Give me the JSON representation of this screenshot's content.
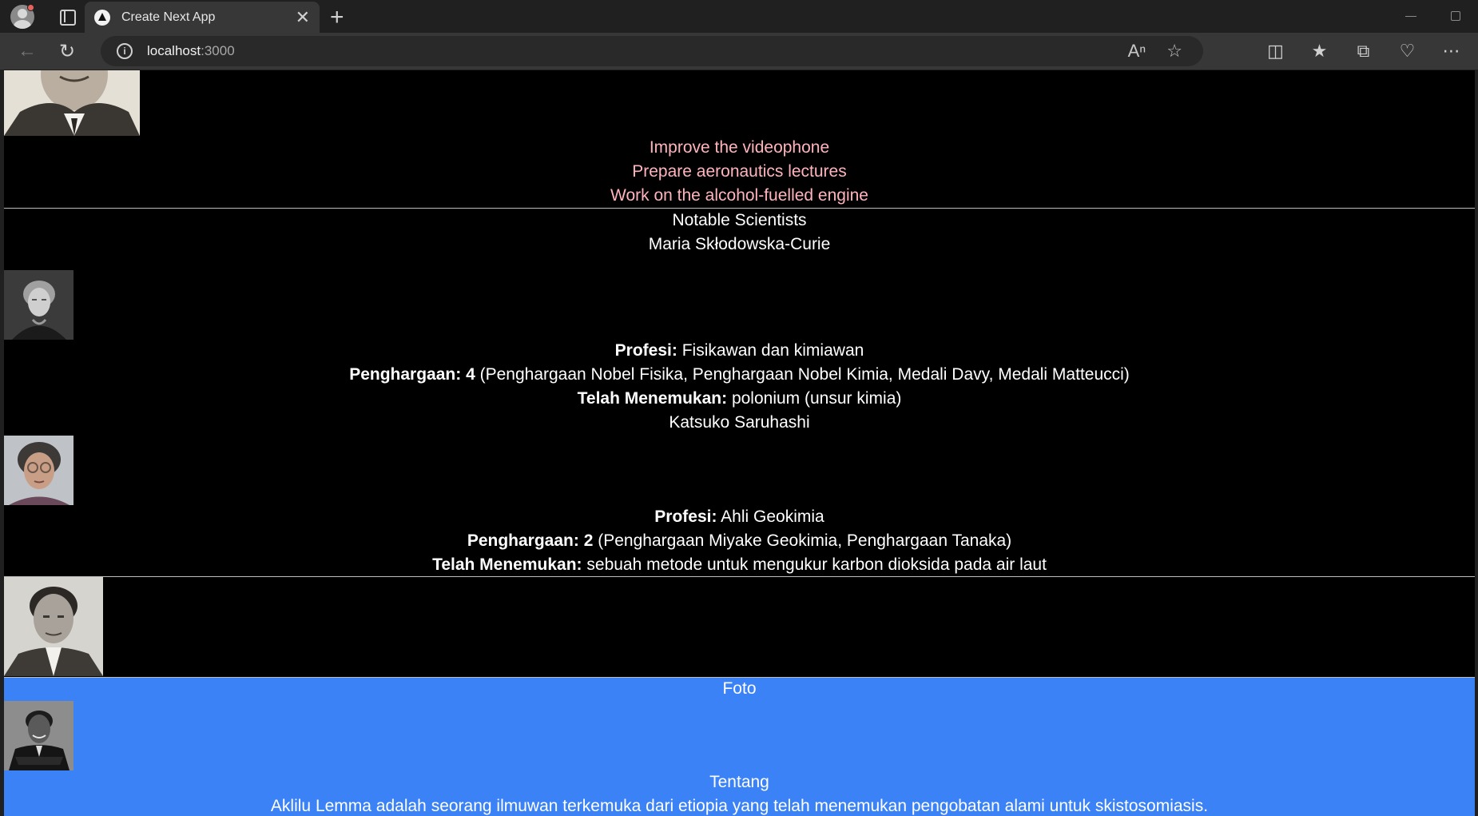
{
  "browser": {
    "tab_title": "Create Next App",
    "url_host": "localhost",
    "url_port": ":3000",
    "new_tab_label": "+",
    "close_tab_label": "✕"
  },
  "page": {
    "todo_items": [
      "Improve the videophone",
      "Prepare aeronautics lectures",
      "Work on the alcohol-fuelled engine"
    ],
    "section_title": "Notable Scientists",
    "profession_label": "Profesi:",
    "awards_label": "Penghargaan:",
    "discovered_label": "Telah Menemukan:",
    "scientists": [
      {
        "name": "Maria Skłodowska-Curie",
        "profession": "Fisikawan dan kimiawan",
        "award_count": "4",
        "awards": "(Penghargaan Nobel Fisika, Penghargaan Nobel Kimia, Medali Davy, Medali Matteucci)",
        "discovered": "polonium (unsur kimia)"
      },
      {
        "name": "Katsuko Saruhashi",
        "profession": "Ahli Geokimia",
        "award_count": "2",
        "awards": "(Penghargaan Miyake Geokimia, Penghargaan Tanaka)",
        "discovered": "sebuah metode untuk mengukur karbon dioksida pada air laut"
      }
    ],
    "blue_section": {
      "photo_heading": "Foto",
      "about_heading": "Tentang",
      "about_text": "Aklilu Lemma adalah seorang ilmuwan terkemuka dari etiopia yang telah menemukan pengobatan alami untuk skistosomiasis."
    },
    "colors": {
      "page_bg": "#000000",
      "text": "#ffffff",
      "todo_text": "#ffb4bd",
      "blue_section": "#3b82f6"
    }
  }
}
